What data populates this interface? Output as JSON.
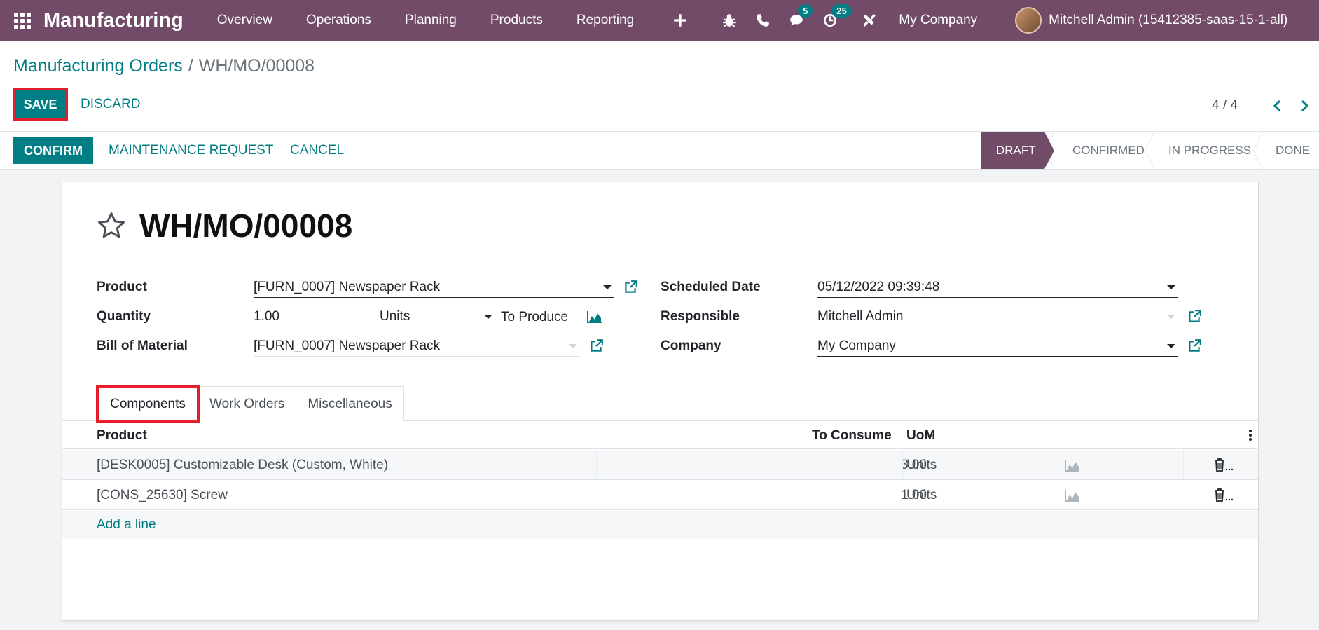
{
  "navbar": {
    "brand": "Manufacturing",
    "menu": [
      "Overview",
      "Operations",
      "Planning",
      "Products",
      "Reporting"
    ],
    "icons": [
      "apps-grid-icon",
      "plus-icon",
      "bug-icon",
      "phone-icon",
      "chat-icon",
      "activity-clock-icon",
      "tools-icon"
    ],
    "messages_count": "5",
    "activities_count": "25",
    "company": "My Company",
    "user": "Mitchell Admin (15412385-saas-15-1-all)"
  },
  "breadcrumb": {
    "parent": "Manufacturing Orders",
    "separator": "/",
    "current": "WH/MO/00008"
  },
  "actions": {
    "save": "SAVE",
    "discard": "DISCARD"
  },
  "pager": {
    "value": "4 / 4"
  },
  "statusbar": {
    "confirm": "CONFIRM",
    "maintenance": "MAINTENANCE REQUEST",
    "cancel": "CANCEL",
    "stages": [
      "DRAFT",
      "CONFIRMED",
      "IN PROGRESS",
      "DONE"
    ],
    "active_stage": "DRAFT"
  },
  "form": {
    "title": "WH/MO/00008",
    "product_label": "Product",
    "product_value": "[FURN_0007] Newspaper Rack",
    "quantity_label": "Quantity",
    "quantity_value": "1.00",
    "uom_value": "Units",
    "to_produce": "To Produce",
    "bom_label": "Bill of Material",
    "bom_value": "[FURN_0007] Newspaper Rack",
    "scheduled_label": "Scheduled Date",
    "scheduled_value": "05/12/2022 09:39:48",
    "responsible_label": "Responsible",
    "responsible_value": "Mitchell Admin",
    "company_label": "Company",
    "company_value": "My Company"
  },
  "tabs": [
    "Components",
    "Work Orders",
    "Miscellaneous"
  ],
  "components": {
    "headers": {
      "product": "Product",
      "to_consume": "To Consume",
      "uom": "UoM"
    },
    "rows": [
      {
        "product": "[DESK0005] Customizable Desk (Custom, White)",
        "to_consume": "3.00",
        "uom": "Units"
      },
      {
        "product": "[CONS_25630] Screw",
        "to_consume": "1.00",
        "uom": "Units"
      }
    ],
    "add_line": "Add a line"
  },
  "colors": {
    "primary": "#714b67",
    "accent": "#017e84",
    "highlight": "#e31e2a"
  }
}
